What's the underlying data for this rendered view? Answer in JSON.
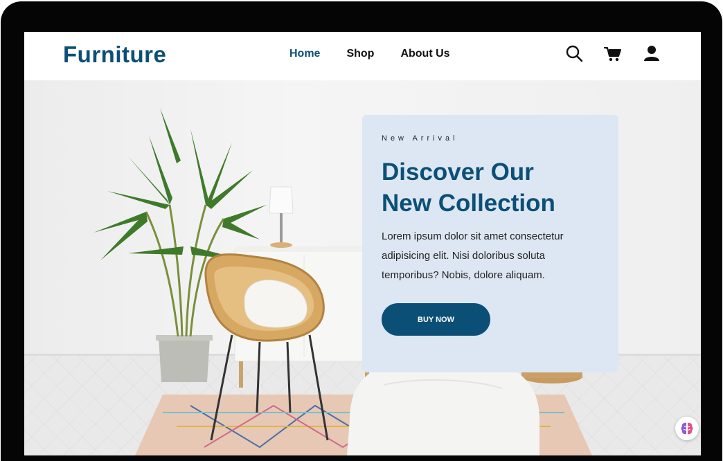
{
  "header": {
    "logo": "Furniture",
    "nav": [
      {
        "label": "Home",
        "active": true
      },
      {
        "label": "Shop",
        "active": false
      },
      {
        "label": "About Us",
        "active": false
      }
    ],
    "icons": [
      "search-icon",
      "cart-icon",
      "user-icon"
    ]
  },
  "hero": {
    "eyebrow": "New Arrival",
    "title_line1": "Discover Our",
    "title_line2": "New Collection",
    "description": "Lorem ipsum dolor sit amet consectetur adipisicing elit. Nisi doloribus soluta temporibus? Nobis, dolore aliquam.",
    "button_label": "BUY NOW"
  },
  "colors": {
    "brand": "#0c4f76",
    "card_bg": "#dde7f3",
    "device_frame": "#050505"
  },
  "floating_widget": {
    "icon": "brain-icon"
  }
}
